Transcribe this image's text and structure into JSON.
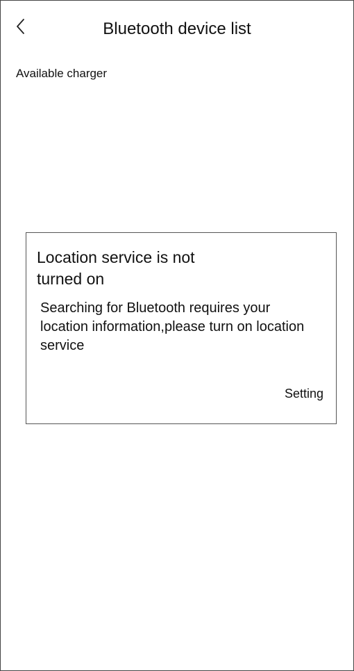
{
  "header": {
    "title": "Bluetooth device list",
    "back_icon": "chevron-left-icon"
  },
  "section": {
    "label": "Available charger"
  },
  "dialog": {
    "title": "Location service is not turned on",
    "message": "Searching for Bluetooth requires your location information,please turn on location service",
    "action_label": "Setting"
  }
}
